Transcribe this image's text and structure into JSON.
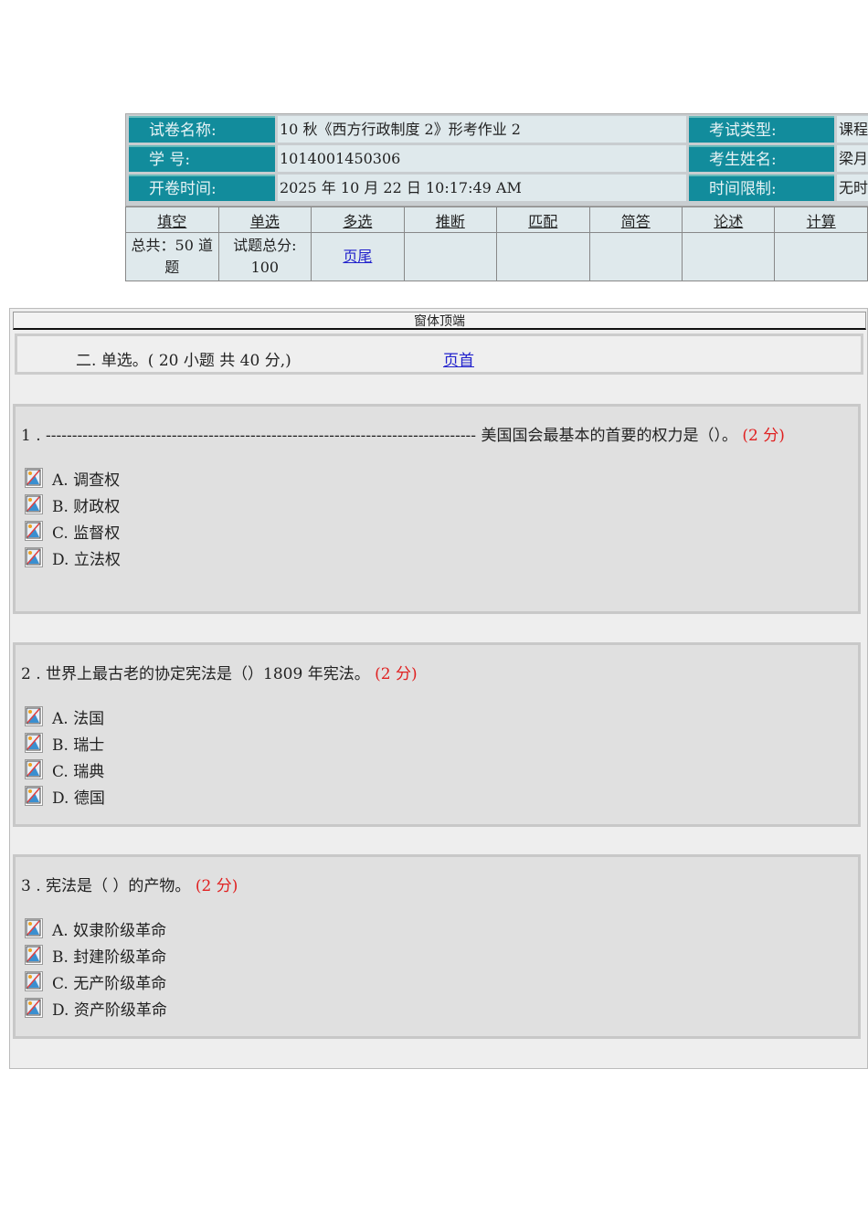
{
  "header": {
    "rows": [
      {
        "label": "试卷名称:",
        "value": "10 秋《西方行政制度 2》形考作业 2",
        "label2": "考试类型:",
        "value2": "课程"
      },
      {
        "label": "学  号:",
        "value": "1014001450306",
        "label2": "考生姓名:",
        "value2": "梁月"
      },
      {
        "label": "开卷时间:",
        "value": "2025 年 10 月 22 日  10:17:49  AM",
        "label2": "时间限制:",
        "value2": "无时"
      }
    ]
  },
  "tabs": [
    "填空",
    "单选",
    "多选",
    "推断",
    "匹配",
    "简答",
    "论述",
    "计算"
  ],
  "summary": {
    "total": "总共：50 道题",
    "score_label": "试题总分:",
    "score": "100",
    "footer_link": "页尾"
  },
  "frame": {
    "title": "窗体顶端",
    "section": "二. 单选。( 20 小题 共 40 分,)",
    "top_link": "页首"
  },
  "questions": [
    {
      "text": "1 . ---------------------------------------------------------------------------------- 美国国会最基本的首要的权力是（）。",
      "points": "(2 分)",
      "options": [
        "A. 调查权",
        "B. 财政权",
        "C. 监督权",
        "D. 立法权"
      ]
    },
    {
      "text": "2 . 世界上最古老的协定宪法是（）1809 年宪法。",
      "points": "(2 分)",
      "options": [
        "A. 法国",
        "B. 瑞士",
        "C. 瑞典",
        "D. 德国"
      ]
    },
    {
      "text": "3 . 宪法是（ ）的产物。",
      "points": "(2 分)",
      "options": [
        "A. 奴隶阶级革命",
        "B. 封建阶级革命",
        "C. 无产阶级革命",
        "D. 资产阶级革命"
      ]
    }
  ]
}
